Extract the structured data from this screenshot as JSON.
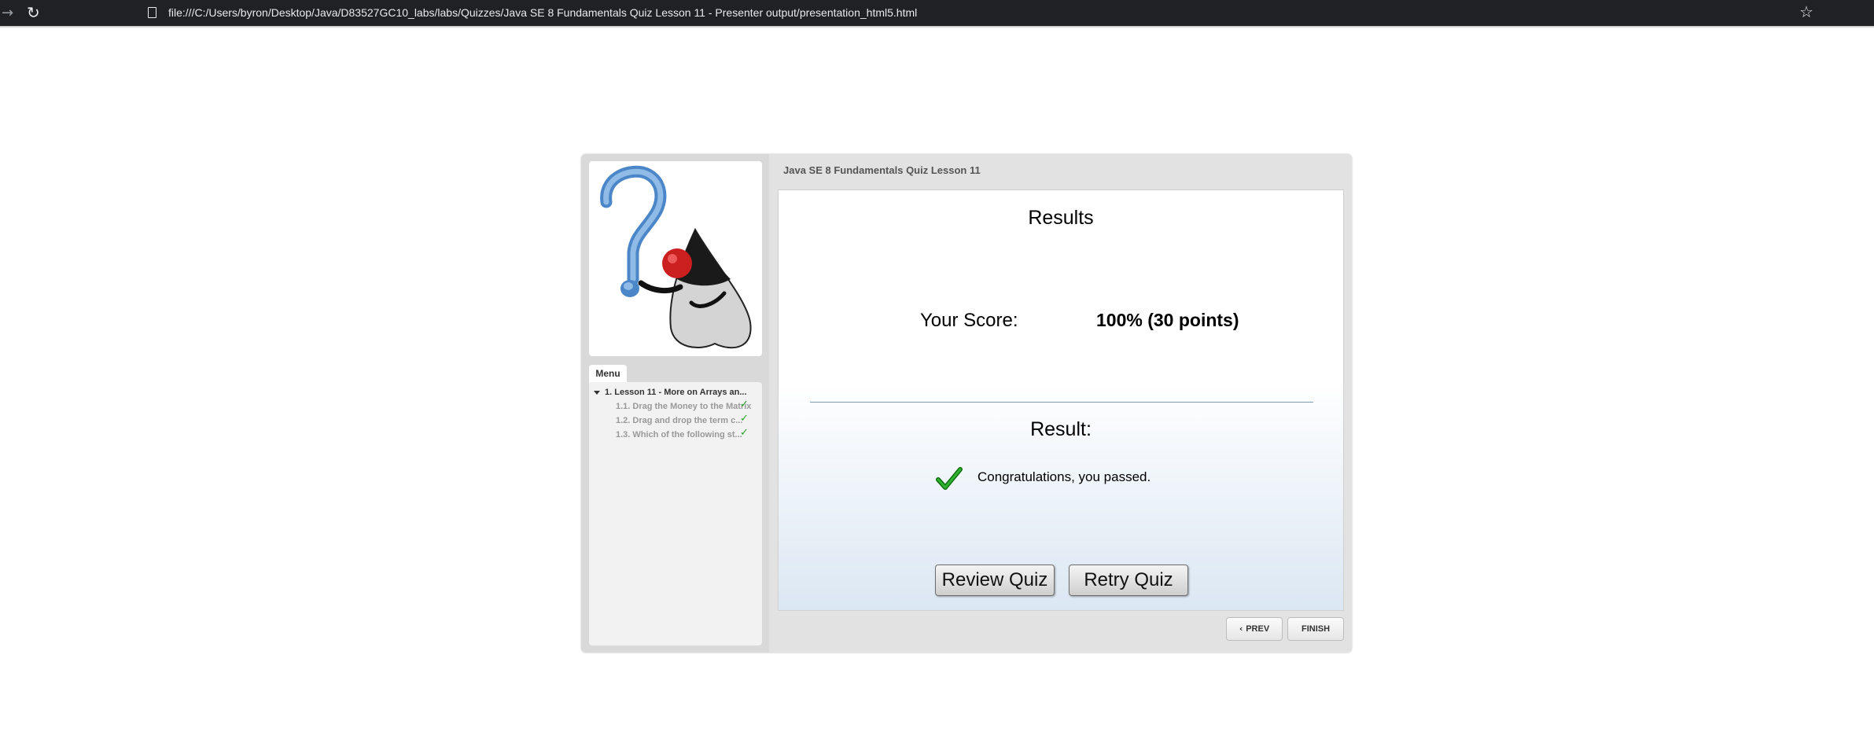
{
  "browser": {
    "url": "file:///C:/Users/byron/Desktop/Java/D83527GC10_labs/labs/Quizzes/Java SE 8 Fundamentals Quiz Lesson 11 - Presenter output/presentation_html5.html"
  },
  "player": {
    "title": "Java SE 8 Fundamentals Quiz Lesson 11",
    "menu_tab": "Menu",
    "menu": {
      "section": "1. Lesson 11 - More on Arrays an...",
      "items": [
        {
          "label": "1.1. Drag the Money to the Matrix",
          "completed": true
        },
        {
          "label": "1.2. Drag and drop the term c...",
          "completed": true
        },
        {
          "label": "1.3. Which of the following st...",
          "completed": true
        }
      ]
    },
    "prev_label": "PREV",
    "finish_label": "FINISH"
  },
  "slide": {
    "results_title": "Results",
    "score_label": "Your Score:",
    "score_value": "100% (30 points)",
    "result_label": "Result:",
    "result_message": "Congratulations, you passed.",
    "review_button": "Review Quiz",
    "retry_button": "Retry Quiz"
  },
  "colors": {
    "pass_check": "#1e8c1e",
    "menu_check": "#2aa22a",
    "browser_bar": "#202124"
  }
}
